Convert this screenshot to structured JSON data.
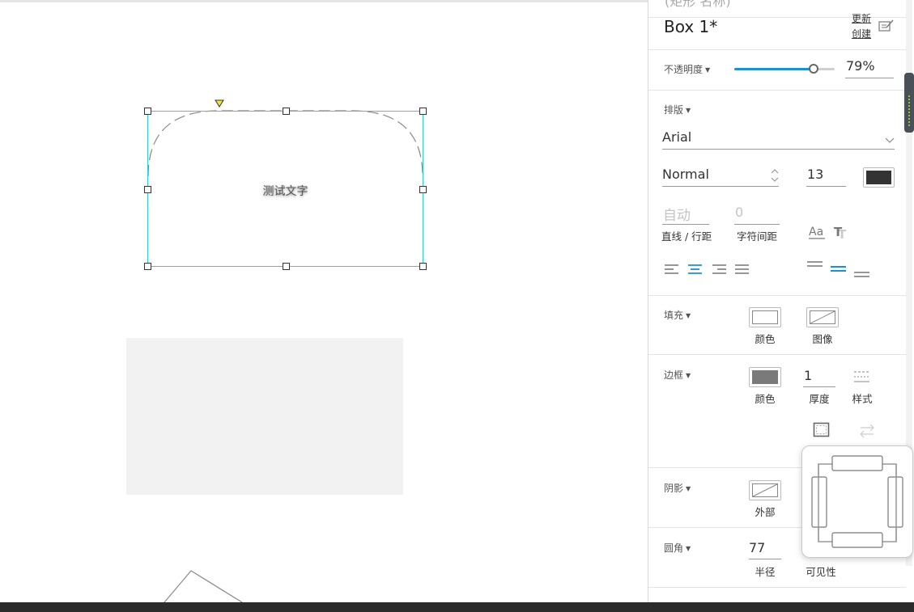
{
  "panel": {
    "header_cut": "(矩形 名称)",
    "widget_name": "Box 1*",
    "update_link": "更新",
    "create_link": "创建",
    "opacity": {
      "label": "不透明度",
      "value": "79%",
      "fraction": 0.79
    },
    "typography": {
      "label": "排版",
      "font_family": "Arial",
      "font_weight": "Normal",
      "font_size": "13",
      "text_color": "#333333",
      "line_spacing_placeholder": "自动",
      "line_spacing_label": "直线 / 行距",
      "char_spacing_value": "0",
      "char_spacing_label": "字符间距"
    },
    "fill": {
      "label": "填充",
      "color_label": "颜色",
      "image_label": "图像"
    },
    "border": {
      "label": "边框",
      "color_label": "颜色",
      "color_value": "#7a7a7a",
      "thickness_value": "1",
      "thickness_label": "厚度",
      "style_label": "样式"
    },
    "shadow": {
      "label": "阴影",
      "outer_label": "外部"
    },
    "corner": {
      "label": "圆角",
      "radius_value": "77",
      "radius_label": "半径",
      "visibility_label": "可见性"
    }
  },
  "canvas": {
    "selected_text": "测试文字",
    "accent": "#2bd0d4"
  }
}
